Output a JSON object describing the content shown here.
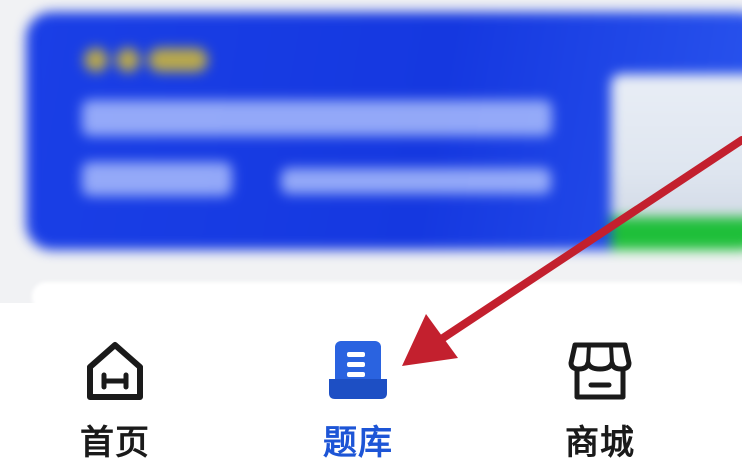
{
  "tab_bar": {
    "items": [
      {
        "label": "首页",
        "icon": "home-icon",
        "active": false
      },
      {
        "label": "题库",
        "icon": "question-bank-icon",
        "active": true
      },
      {
        "label": "商城",
        "icon": "store-icon",
        "active": false
      }
    ]
  },
  "colors": {
    "banner": "#1538e0",
    "active_tab": "#1d55d6",
    "arrow": "#c3202e",
    "tab_text": "#1a1a1a"
  }
}
